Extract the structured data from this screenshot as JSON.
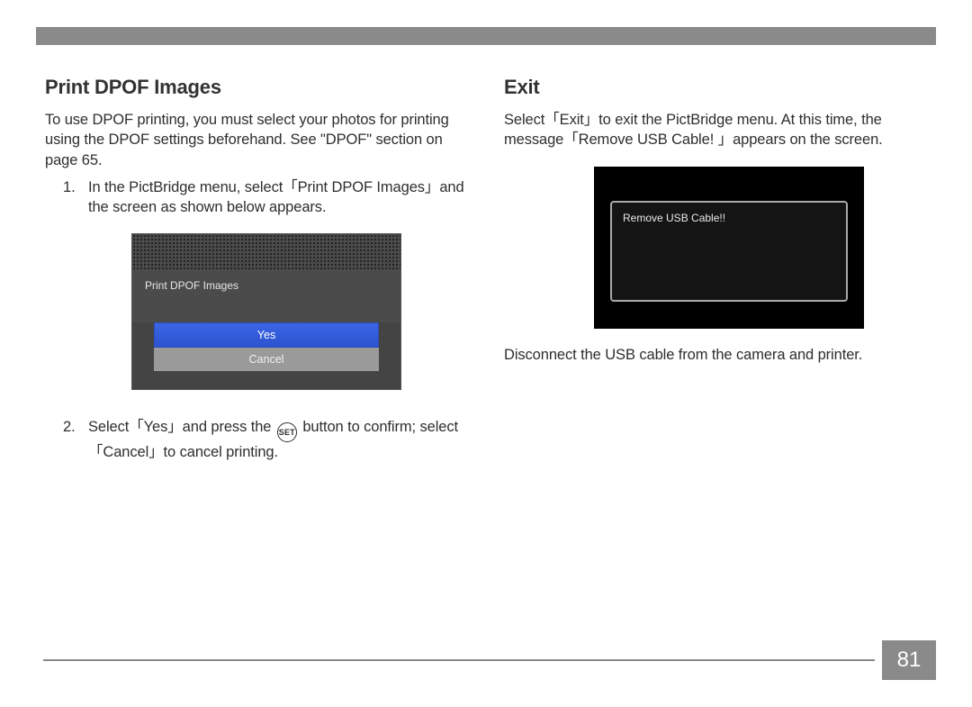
{
  "page_number": "81",
  "left": {
    "heading": "Print DPOF Images",
    "intro": "To use DPOF printing, you must select your photos for printing using the DPOF settings beforehand. See \"DPOF\" section on page 65.",
    "step1": "In the PictBridge menu, select「Print DPOF Images」and the screen as shown below appears.",
    "screen": {
      "title": "Print DPOF Images",
      "option_yes": "Yes",
      "option_cancel": "Cancel"
    },
    "step2a": "Select「Yes」and press the ",
    "set_label": "SET",
    "step2b": " button to confirm; select「Cancel」to cancel printing."
  },
  "right": {
    "heading": "Exit",
    "intro": "Select「Exit」to exit the PictBridge menu. At this time, the message「Remove USB Cable! 」appears on the screen.",
    "screen_message": "Remove USB Cable!!",
    "after": "Disconnect the USB cable from the camera and printer."
  }
}
